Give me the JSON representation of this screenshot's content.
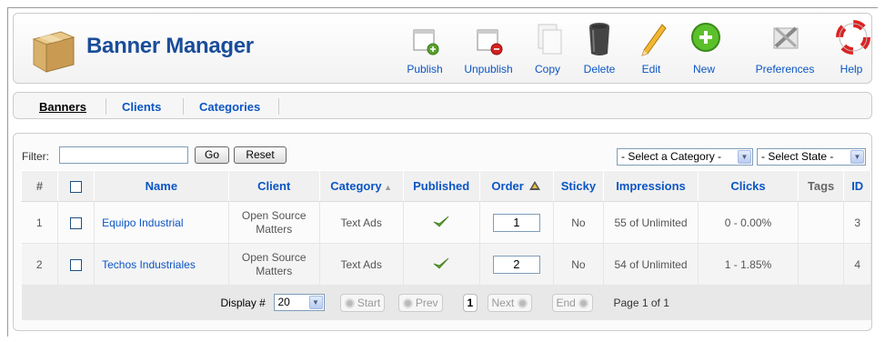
{
  "header": {
    "title": "Banner Manager"
  },
  "toolbar": {
    "publish": "Publish",
    "unpublish": "Unpublish",
    "copy": "Copy",
    "delete": "Delete",
    "edit": "Edit",
    "new": "New",
    "preferences": "Preferences",
    "help": "Help"
  },
  "submenu": [
    "Banners",
    "Clients",
    "Categories"
  ],
  "filter": {
    "label": "Filter:",
    "value": "",
    "go": "Go",
    "reset": "Reset",
    "category_select": "- Select a Category -",
    "state_select": "- Select State -"
  },
  "table": {
    "headers": {
      "num": "#",
      "name": "Name",
      "client": "Client",
      "category": "Category",
      "published": "Published",
      "order": "Order",
      "sticky": "Sticky",
      "impressions": "Impressions",
      "clicks": "Clicks",
      "tags": "Tags",
      "id": "ID"
    },
    "rows": [
      {
        "num": "1",
        "name": "Equipo Industrial",
        "client1": "Open Source",
        "client2": "Matters",
        "category": "Text Ads",
        "order": "1",
        "sticky": "No",
        "impressions": "55 of Unlimited",
        "clicks": "0 - 0.00%",
        "tags": "",
        "id": "3"
      },
      {
        "num": "2",
        "name": "Techos Industriales",
        "client1": "Open Source",
        "client2": "Matters",
        "category": "Text Ads",
        "order": "2",
        "sticky": "No",
        "impressions": "54 of Unlimited",
        "clicks": "1 - 1.85%",
        "tags": "",
        "id": "4"
      }
    ]
  },
  "pagination": {
    "display_label": "Display #",
    "display_value": "20",
    "start": "Start",
    "prev": "Prev",
    "current": "1",
    "next": "Next",
    "end": "End",
    "page_info": "Page 1 of 1"
  },
  "colors": {
    "link": "#0b55c4",
    "title": "#1a4d99",
    "check": "#5aa02c"
  }
}
